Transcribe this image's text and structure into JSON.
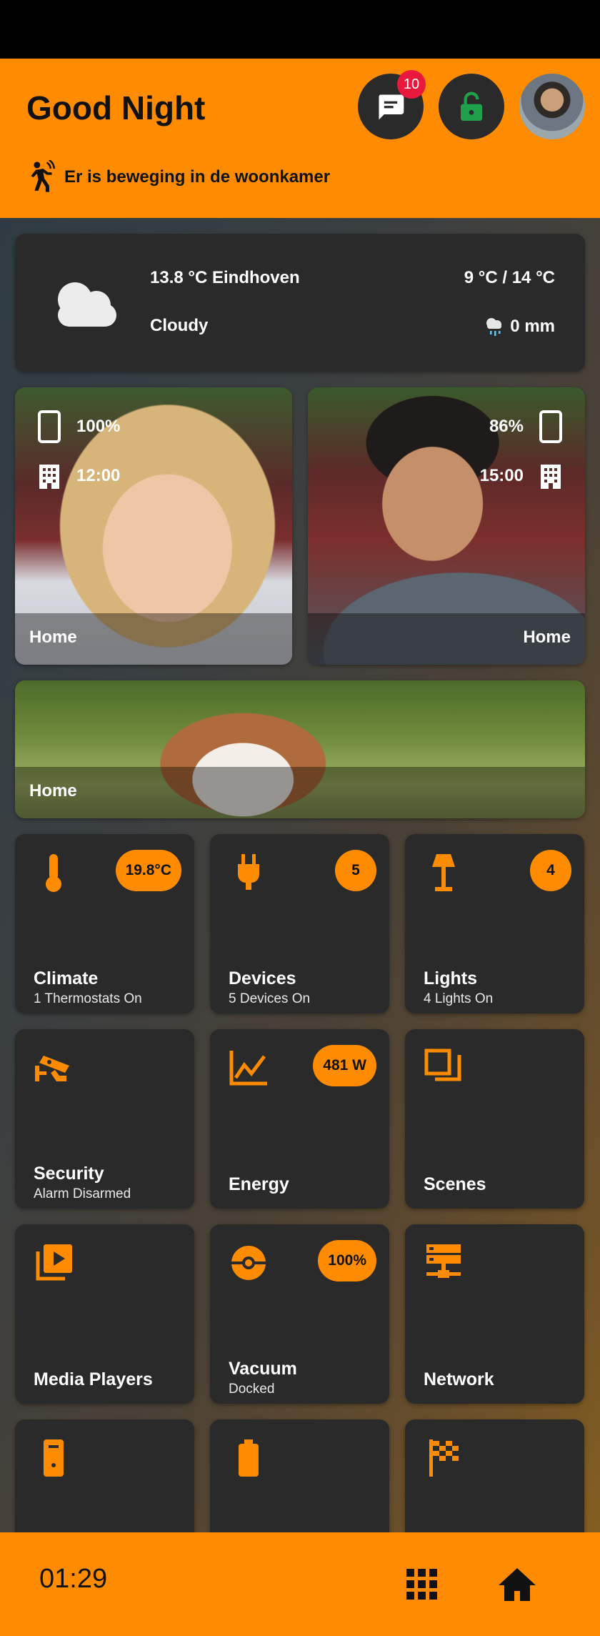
{
  "header": {
    "greeting": "Good Night",
    "notification_count": "10",
    "motion_text": "Er is beweging in de woonkamer"
  },
  "weather": {
    "temp_location": "13.8 °C Eindhoven",
    "condition": "Cloudy",
    "range": "9 °C / 14 °C",
    "rain": "0 mm"
  },
  "persons": [
    {
      "battery": "100%",
      "time": "12:00",
      "location": "Home"
    },
    {
      "battery": "86%",
      "time": "15:00",
      "location": "Home"
    }
  ],
  "pet": {
    "location": "Home"
  },
  "tiles": [
    {
      "title": "Climate",
      "subtitle": "1 Thermostats On",
      "badge": "19.8°C",
      "icon": "thermometer-icon"
    },
    {
      "title": "Devices",
      "subtitle": "5 Devices On",
      "badge": "5",
      "icon": "plug-icon"
    },
    {
      "title": "Lights",
      "subtitle": "4 Lights On",
      "badge": "4",
      "icon": "lamp-icon"
    },
    {
      "title": "Security",
      "subtitle": "Alarm Disarmed",
      "badge": "",
      "icon": "cctv-icon"
    },
    {
      "title": "Energy",
      "subtitle": "",
      "badge": "481 W",
      "icon": "chart-line-icon"
    },
    {
      "title": "Scenes",
      "subtitle": "",
      "badge": "",
      "icon": "scenes-icon"
    },
    {
      "title": "Media Players",
      "subtitle": "",
      "badge": "",
      "icon": "play-box-icon"
    },
    {
      "title": "Vacuum",
      "subtitle": "Docked",
      "badge": "100%",
      "icon": "robot-vacuum-icon"
    },
    {
      "title": "Network",
      "subtitle": "",
      "badge": "",
      "icon": "server-network-icon"
    }
  ],
  "footer": {
    "time": "01:29"
  },
  "colors": {
    "accent": "#ff8c00",
    "card": "#2a2a2a",
    "badge": "#e8193c",
    "lock": "#1ea14a"
  }
}
